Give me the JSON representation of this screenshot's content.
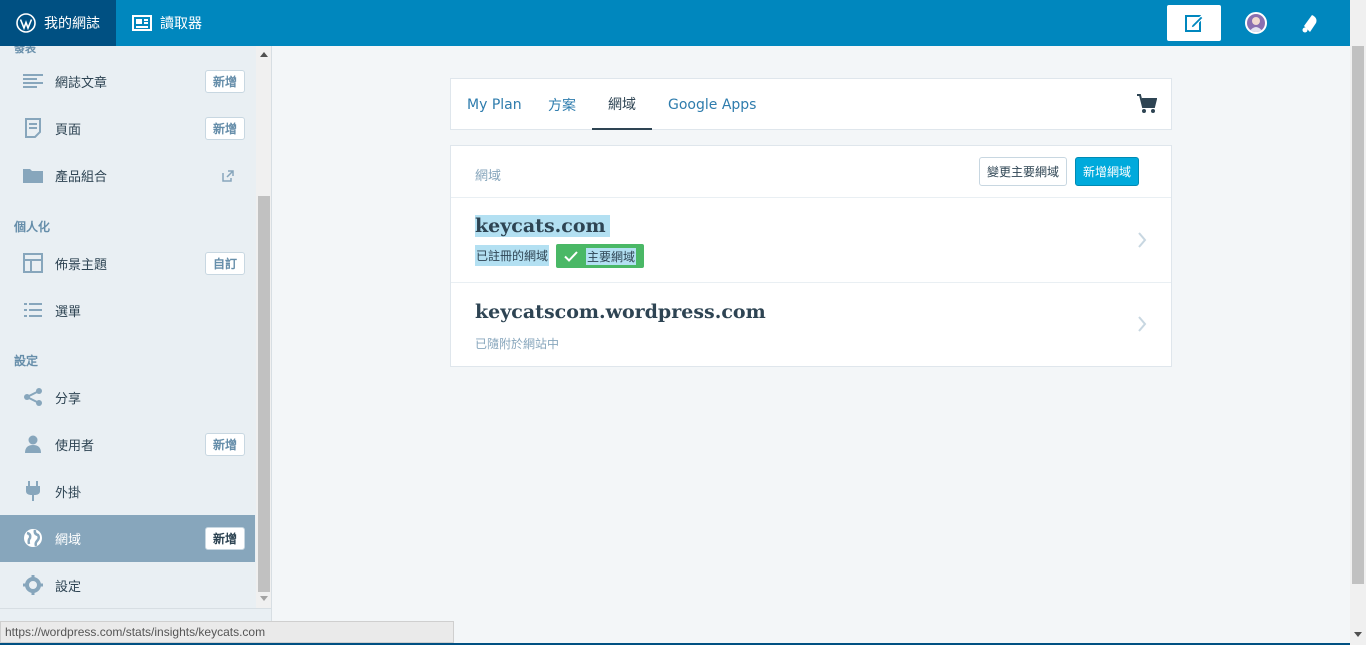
{
  "masterbar": {
    "my_sites": "我的網誌",
    "reader": "讀取器"
  },
  "sidebar": {
    "cutoff_heading": "發表",
    "sections": [
      {
        "heading": ""
      },
      {
        "heading": "個人化"
      },
      {
        "heading": "設定"
      }
    ],
    "items": [
      {
        "label": "網誌文章",
        "badge": "新增",
        "icon": "posts-icon"
      },
      {
        "label": "頁面",
        "badge": "新增",
        "icon": "pages-icon"
      },
      {
        "label": "產品組合",
        "badge": "",
        "icon": "folder-icon"
      },
      {
        "label": "佈景主題",
        "badge": "自訂",
        "icon": "themes-icon"
      },
      {
        "label": "選單",
        "badge": "",
        "icon": "menus-icon"
      },
      {
        "label": "分享",
        "badge": "",
        "icon": "share-icon"
      },
      {
        "label": "使用者",
        "badge": "新增",
        "icon": "user-icon"
      },
      {
        "label": "外掛",
        "badge": "",
        "icon": "plugin-icon"
      },
      {
        "label": "網域",
        "badge": "新增",
        "icon": "globe-icon",
        "selected": true
      },
      {
        "label": "設定",
        "badge": "",
        "icon": "gear-icon"
      }
    ]
  },
  "tabs": [
    {
      "label": "My Plan"
    },
    {
      "label": "方案"
    },
    {
      "label": "網域",
      "active": true
    },
    {
      "label": "Google Apps"
    }
  ],
  "domains": {
    "title": "網域",
    "change_primary": "變更主要網域",
    "add_domain": "新增網域",
    "list": [
      {
        "name": "keycats.com",
        "status": "已註冊的網域",
        "badge": "主要網域"
      },
      {
        "name": "keycatscom.wordpress.com",
        "status": "已隨附於網站中"
      }
    ]
  },
  "status_bar": "https://wordpress.com/stats/insights/keycats.com",
  "colors": {
    "masterbar": "#0087be",
    "masterbar_active": "#005082",
    "sidebar_bg": "#e9eff3",
    "selected_item": "#87a6bc",
    "primary_button": "#00aadc",
    "success_badge": "#4ab866",
    "highlight": "#b3e0f2"
  }
}
